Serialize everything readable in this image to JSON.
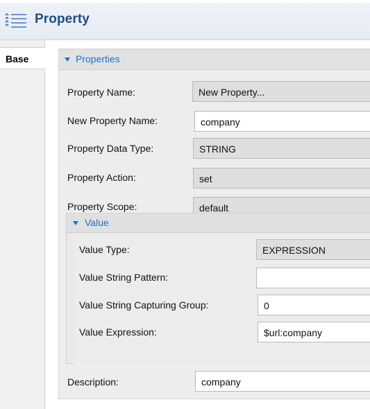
{
  "header": {
    "title": "Property",
    "icon": "list-bullets-icon"
  },
  "tabs": [
    {
      "label": "Base",
      "active": true
    }
  ],
  "properties_section": {
    "label": "Properties",
    "rows": {
      "property_name": {
        "label": "Property Name:",
        "value": "New Property...",
        "editable": false
      },
      "new_property_name": {
        "label": "New Property Name:",
        "value": "company",
        "editable": true
      },
      "property_data_type": {
        "label": "Property Data Type:",
        "value": "STRING",
        "editable": false
      },
      "property_action": {
        "label": "Property Action:",
        "value": "set",
        "editable": false
      },
      "property_scope": {
        "label": "Property Scope:",
        "value": "default",
        "editable": false
      }
    }
  },
  "value_section": {
    "label": "Value",
    "rows": {
      "value_type": {
        "label": "Value Type:",
        "value": "EXPRESSION",
        "editable": false
      },
      "value_string_pattern": {
        "label": "Value String Pattern:",
        "value": "",
        "editable": true
      },
      "value_string_capturing_group": {
        "label": "Value String Capturing Group:",
        "value": "0",
        "editable": true
      },
      "value_expression": {
        "label": "Value Expression:",
        "value": "$url:company",
        "editable": true
      }
    }
  },
  "description": {
    "label": "Description:",
    "value": "company",
    "editable": true
  },
  "colors": {
    "accent": "#1a73c8",
    "title": "#1c4e8a"
  }
}
